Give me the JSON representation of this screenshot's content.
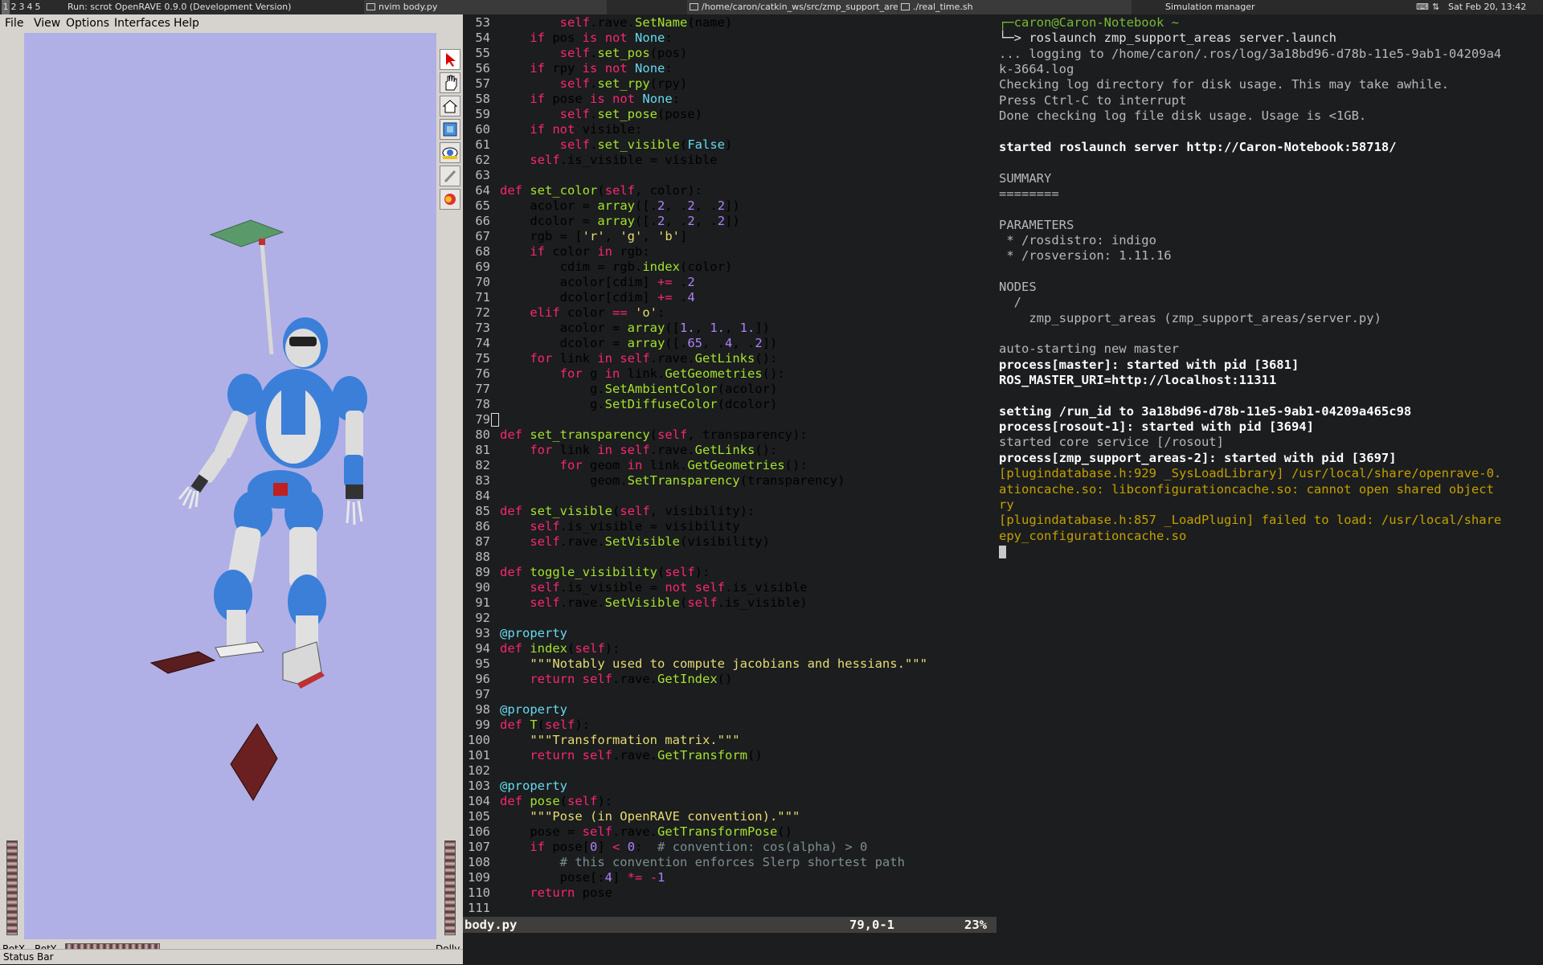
{
  "taskbar": {
    "workspaces": [
      "1",
      "2",
      "3",
      "4",
      "5"
    ],
    "run_label": "Run: scrot",
    "windows": [
      {
        "title": "OpenRAVE 0.9.0 (Development Version)"
      },
      {
        "title": "nvim body.py"
      },
      {
        "title": "/home/caron/catkin_ws/src/zmp_support_areas/launch..."
      },
      {
        "title": "./real_time.sh"
      },
      {
        "title": "Simulation manager"
      }
    ],
    "clock": "Sat Feb 20, 13:42"
  },
  "openrave": {
    "menu": [
      "File",
      "View",
      "Options",
      "Interfaces",
      "Help"
    ],
    "tools": [
      "select-arrow-icon",
      "hand-icon",
      "camera-icon",
      "view-all-icon",
      "eye-icon",
      "pin-icon",
      "color-icon"
    ],
    "bottom": {
      "rotx": "RotX",
      "roty": "RotY",
      "dolly": "Dolly"
    },
    "status_bar": "Status Bar"
  },
  "vim": {
    "lines": [
      {
        "n": "53",
        "code": "        self.rave.SetName(name)"
      },
      {
        "n": "54",
        "code": "    if pos is not None:"
      },
      {
        "n": "55",
        "code": "        self.set_pos(pos)"
      },
      {
        "n": "56",
        "code": "    if rpy is not None:"
      },
      {
        "n": "57",
        "code": "        self.set_rpy(rpy)"
      },
      {
        "n": "58",
        "code": "    if pose is not None:"
      },
      {
        "n": "59",
        "code": "        self.set_pose(pose)"
      },
      {
        "n": "60",
        "code": "    if not visible:"
      },
      {
        "n": "61",
        "code": "        self.set_visible(False)"
      },
      {
        "n": "62",
        "code": "    self.is_visible = visible"
      },
      {
        "n": "63",
        "code": ""
      },
      {
        "n": "64",
        "code": "def set_color(self, color):"
      },
      {
        "n": "65",
        "code": "    acolor = array([.2, .2, .2])"
      },
      {
        "n": "66",
        "code": "    dcolor = array([.2, .2, .2])"
      },
      {
        "n": "67",
        "code": "    rgb = ['r', 'g', 'b']"
      },
      {
        "n": "68",
        "code": "    if color in rgb:"
      },
      {
        "n": "69",
        "code": "        cdim = rgb.index(color)"
      },
      {
        "n": "70",
        "code": "        acolor[cdim] += .2"
      },
      {
        "n": "71",
        "code": "        dcolor[cdim] += .4"
      },
      {
        "n": "72",
        "code": "    elif color == 'o':"
      },
      {
        "n": "73",
        "code": "        acolor = array([1., 1., 1.])"
      },
      {
        "n": "74",
        "code": "        dcolor = array([.65, .4, .2])"
      },
      {
        "n": "75",
        "code": "    for link in self.rave.GetLinks():"
      },
      {
        "n": "76",
        "code": "        for g in link.GetGeometries():"
      },
      {
        "n": "77",
        "code": "            g.SetAmbientColor(acolor)"
      },
      {
        "n": "78",
        "code": "            g.SetDiffuseColor(dcolor)"
      },
      {
        "n": "79",
        "code": ""
      },
      {
        "n": "80",
        "code": "def set_transparency(self, transparency):"
      },
      {
        "n": "81",
        "code": "    for link in self.rave.GetLinks():"
      },
      {
        "n": "82",
        "code": "        for geom in link.GetGeometries():"
      },
      {
        "n": "83",
        "code": "            geom.SetTransparency(transparency)"
      },
      {
        "n": "84",
        "code": ""
      },
      {
        "n": "85",
        "code": "def set_visible(self, visibility):"
      },
      {
        "n": "86",
        "code": "    self.is_visible = visibility"
      },
      {
        "n": "87",
        "code": "    self.rave.SetVisible(visibility)"
      },
      {
        "n": "88",
        "code": ""
      },
      {
        "n": "89",
        "code": "def toggle_visibility(self):"
      },
      {
        "n": "90",
        "code": "    self.is_visible = not self.is_visible"
      },
      {
        "n": "91",
        "code": "    self.rave.SetVisible(self.is_visible)"
      },
      {
        "n": "92",
        "code": ""
      },
      {
        "n": "93",
        "code": "@property"
      },
      {
        "n": "94",
        "code": "def index(self):"
      },
      {
        "n": "95",
        "code": "    \"\"\"Notably used to compute jacobians and hessians.\"\"\""
      },
      {
        "n": "96",
        "code": "    return self.rave.GetIndex()"
      },
      {
        "n": "97",
        "code": ""
      },
      {
        "n": "98",
        "code": "@property"
      },
      {
        "n": "99",
        "code": "def T(self):"
      },
      {
        "n": "100",
        "code": "    \"\"\"Transformation matrix.\"\"\""
      },
      {
        "n": "101",
        "code": "    return self.rave.GetTransform()"
      },
      {
        "n": "102",
        "code": ""
      },
      {
        "n": "103",
        "code": "@property"
      },
      {
        "n": "104",
        "code": "def pose(self):"
      },
      {
        "n": "105",
        "code": "    \"\"\"Pose (in OpenRAVE convention).\"\"\""
      },
      {
        "n": "106",
        "code": "    pose = self.rave.GetTransformPose()"
      },
      {
        "n": "107",
        "code": "    if pose[0] < 0:  # convention: cos(alpha) > 0"
      },
      {
        "n": "108",
        "code": "        # this convention enforces Slerp shortest path"
      },
      {
        "n": "109",
        "code": "        pose[:4] *= -1"
      },
      {
        "n": "110",
        "code": "    return pose"
      },
      {
        "n": "111",
        "code": ""
      }
    ],
    "status": {
      "file": "body.py",
      "position": "79,0-1",
      "percent": "23%"
    }
  },
  "terminal": {
    "lines": [
      {
        "t": "caron@Caron-Notebook ~",
        "s": "prompt"
      },
      {
        "t": "  roslaunch zmp_support_areas server.launch",
        "s": "cmd"
      },
      {
        "t": "... logging to /home/caron/.ros/log/3a18bd96-d78b-11e5-9ab1-04209a4",
        "s": ""
      },
      {
        "t": "k-3664.log",
        "s": ""
      },
      {
        "t": "Checking log directory for disk usage. This may take awhile.",
        "s": ""
      },
      {
        "t": "Press Ctrl-C to interrupt",
        "s": ""
      },
      {
        "t": "Done checking log file disk usage. Usage is <1GB.",
        "s": ""
      },
      {
        "t": "",
        "s": ""
      },
      {
        "t": "started roslaunch server http://Caron-Notebook:58718/",
        "s": "bold"
      },
      {
        "t": "",
        "s": ""
      },
      {
        "t": "SUMMARY",
        "s": ""
      },
      {
        "t": "========",
        "s": ""
      },
      {
        "t": "",
        "s": ""
      },
      {
        "t": "PARAMETERS",
        "s": ""
      },
      {
        "t": " * /rosdistro: indigo",
        "s": ""
      },
      {
        "t": " * /rosversion: 1.11.16",
        "s": ""
      },
      {
        "t": "",
        "s": ""
      },
      {
        "t": "NODES",
        "s": ""
      },
      {
        "t": "  /",
        "s": ""
      },
      {
        "t": "    zmp_support_areas (zmp_support_areas/server.py)",
        "s": ""
      },
      {
        "t": "",
        "s": ""
      },
      {
        "t": "auto-starting new master",
        "s": ""
      },
      {
        "t": "process[master]: started with pid [3681]",
        "s": "bold"
      },
      {
        "t": "ROS_MASTER_URI=http://localhost:11311",
        "s": "bold"
      },
      {
        "t": "",
        "s": ""
      },
      {
        "t": "setting /run_id to 3a18bd96-d78b-11e5-9ab1-04209a465c98",
        "s": "bold"
      },
      {
        "t": "process[rosout-1]: started with pid [3694]",
        "s": "bold"
      },
      {
        "t": "started core service [/rosout]",
        "s": ""
      },
      {
        "t": "process[zmp_support_areas-2]: started with pid [3697]",
        "s": "bold"
      },
      {
        "t": "[plugindatabase.h:929 _SysLoadLibrary] /usr/local/share/openrave-0.",
        "s": "warn"
      },
      {
        "t": "ationcache.so: libconfigurationcache.so: cannot open shared object",
        "s": "warn"
      },
      {
        "t": "ry",
        "s": "warn"
      },
      {
        "t": "[plugindatabase.h:857 _LoadPlugin] failed to load: /usr/local/share",
        "s": "warn"
      },
      {
        "t": "epy_configurationcache.so",
        "s": "warn"
      }
    ]
  }
}
